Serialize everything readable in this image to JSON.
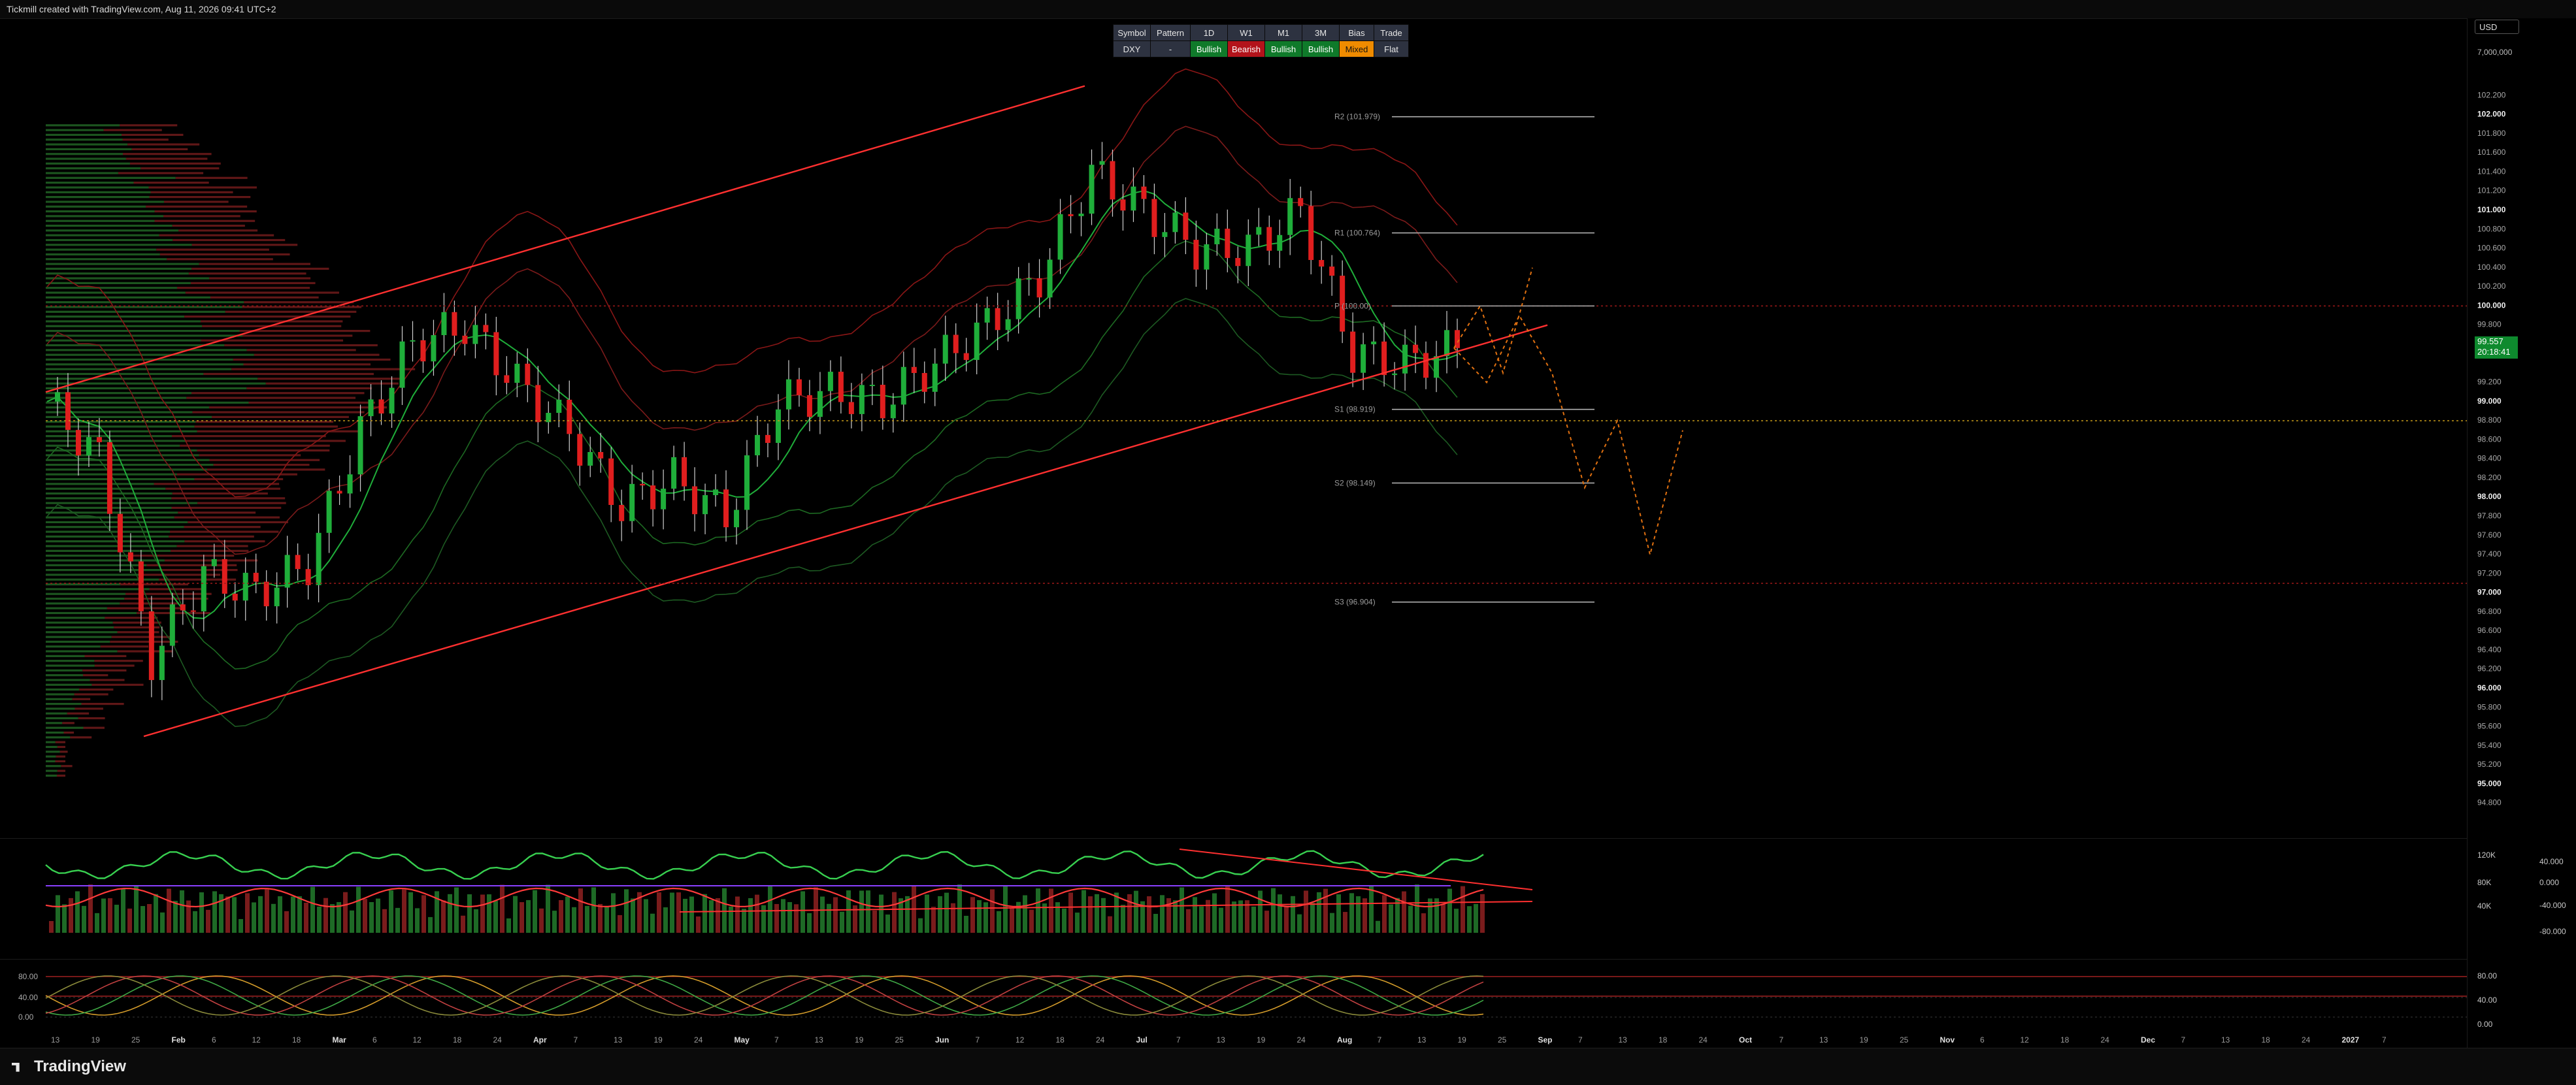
{
  "header": {
    "credit": "Tickmill created with TradingView.com, Aug 11, 2026 09:41 UTC+2"
  },
  "footer": {
    "logo": "TradingView",
    "year_label": "2027"
  },
  "currency": "USD",
  "last_price": {
    "price": "99.557",
    "countdown": "20:18:41"
  },
  "signal_table": {
    "headers": [
      "Symbol",
      "Pattern",
      "1D",
      "W1",
      "M1",
      "3M",
      "Bias",
      "Trade"
    ],
    "values": [
      "DXY",
      "-",
      "Bullish",
      "Bearish",
      "Bullish",
      "Bullish",
      "Mixed",
      "Flat"
    ],
    "colors": {
      "bullish": "#0f7a2a",
      "bearish": "#b3131b",
      "mixed": "#ef8b00",
      "neutral": "#2d3240"
    }
  },
  "pivots": [
    {
      "label": "R2 (101.979)",
      "value": 101.979
    },
    {
      "label": "R1 (100.764)",
      "value": 100.764
    },
    {
      "label": "P (100.00)",
      "value": 100.0
    },
    {
      "label": "S1 (98.919)",
      "value": 98.919
    },
    {
      "label": "S2 (98.149)",
      "value": 98.149
    },
    {
      "label": "S3 (96.904)",
      "value": 96.904
    }
  ],
  "chart_data": [
    {
      "type": "candlestick",
      "symbol": "DXY",
      "ylim": [
        94.6,
        102.4
      ],
      "price_ticks": [
        "102.200",
        "102.000",
        "101.800",
        "101.600",
        "101.400",
        "101.200",
        "101.000",
        "100.800",
        "100.600",
        "100.400",
        "100.200",
        "100.000",
        "99.800",
        "99.200",
        "99.000",
        "98.800",
        "98.600",
        "98.400",
        "98.200",
        "98.000",
        "97.800",
        "97.600",
        "97.400",
        "97.200",
        "97.000",
        "96.800",
        "96.600",
        "96.400",
        "96.200",
        "96.000",
        "95.800",
        "95.600",
        "95.400",
        "95.200",
        "95.000",
        "94.800"
      ],
      "volume_tick_top": "7,000,000",
      "closes_weekly": [
        99.0,
        98.4,
        96.3,
        97.2,
        97.0,
        97.3,
        98.7,
        99.6,
        99.8,
        99.2,
        98.7,
        97.9,
        98.2,
        97.8,
        99.0,
        99.1,
        99.0,
        99.4,
        99.8,
        100.3,
        101.4,
        101.0,
        100.6,
        100.6,
        101.0,
        99.5,
        99.4,
        99.56
      ],
      "x_tick_labels": [
        "13",
        "19",
        "25",
        "Feb",
        "6",
        "12",
        "18",
        "Mar",
        "6",
        "12",
        "18",
        "24",
        "Apr",
        "7",
        "13",
        "19",
        "24",
        "May",
        "7",
        "13",
        "19",
        "25",
        "Jun",
        "7",
        "12",
        "18",
        "24",
        "Jul",
        "7",
        "13",
        "19",
        "24",
        "Aug",
        "7",
        "13",
        "19",
        "25",
        "Sep",
        "7",
        "13",
        "18",
        "24",
        "Oct",
        "7",
        "13",
        "19",
        "25",
        "Nov",
        "6",
        "12",
        "18",
        "24",
        "Dec",
        "7",
        "13",
        "18",
        "24",
        "2027",
        "7"
      ],
      "projection_path": [
        99.56,
        99.2,
        99.9,
        99.3,
        98.1,
        98.8,
        97.4,
        98.7
      ]
    },
    {
      "type": "line",
      "name": "oscillator-volume",
      "ticks_left": [
        "120K",
        "80K",
        "40K"
      ],
      "ticks_right": [
        "40.000",
        "0.000",
        "-40.000",
        "-80.000"
      ]
    },
    {
      "type": "line",
      "name": "stochastic",
      "ticks": [
        "80.00",
        "40.00",
        "0.00"
      ]
    }
  ]
}
